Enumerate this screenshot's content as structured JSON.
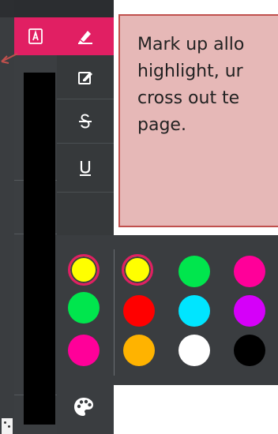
{
  "callout": {
    "lines": [
      "Mark up allo",
      "highlight, ur",
      "cross out te",
      "page."
    ]
  },
  "tools": {
    "markup": "markup-tool-icon",
    "highlight": "highlighter-icon",
    "note": "pencil-note-icon",
    "strikethrough": "strikethrough-icon",
    "underline": "underline-icon",
    "palette": "palette-icon"
  },
  "palette": {
    "current_color": "#ffff00",
    "selected_index": 0,
    "swatches": [
      "#ffff00",
      "#00e64d",
      "#ff0099",
      "#ff0000",
      "#00e5ff",
      "#d500f9",
      "#ff00aa",
      "#ffb300",
      "#ffffff",
      "#ff00cc",
      "#000000",
      "#00ff00"
    ]
  },
  "colors": {
    "accent": "#e11f63",
    "toolbar_bg": "#36393b",
    "callout_bg": "#e6b8b7",
    "callout_border": "#c0504d"
  }
}
